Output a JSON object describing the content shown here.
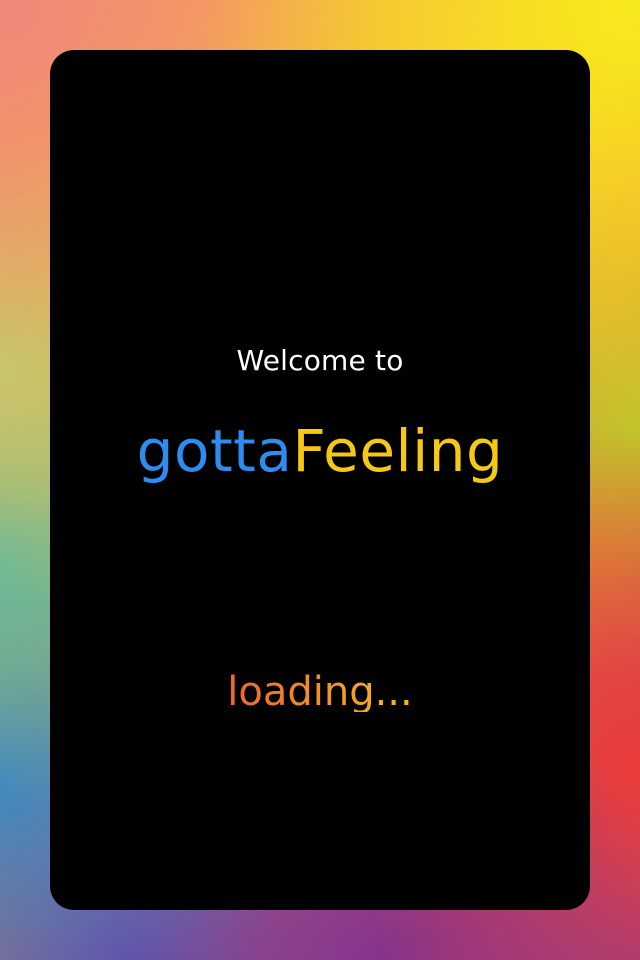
{
  "screen": {
    "welcome_text": "Welcome to",
    "brand": {
      "part1": "gotta",
      "part2": "Feeling"
    },
    "status": "loading..."
  },
  "colors": {
    "card_background": "#000000",
    "welcome_text": "#ffffff",
    "brand_blue": "#2d8cf0",
    "brand_yellow": "#f5c816",
    "loading_red": "#eb3e32",
    "loading_yellow": "#f7d11a"
  }
}
